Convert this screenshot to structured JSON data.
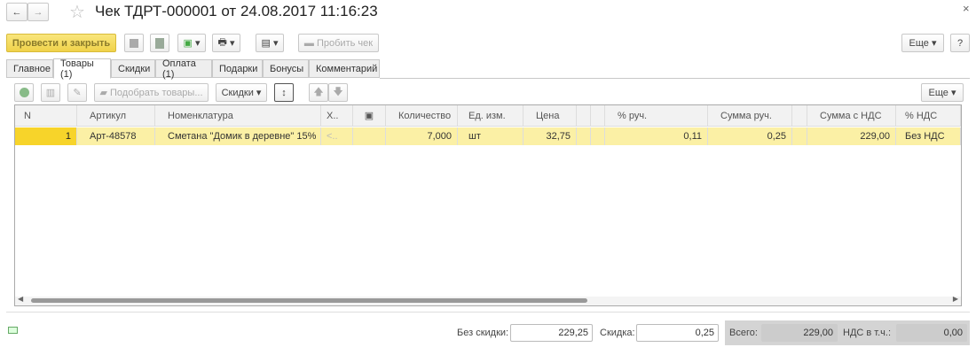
{
  "window": {
    "title": "Чек ТДРТ-000001 от 24.08.2017 11:16:23"
  },
  "toolbar": {
    "post_close": "Провести и закрыть",
    "print_receipt": "Пробить чек",
    "more": "Еще",
    "help": "?"
  },
  "tabs": [
    {
      "label": "Главное"
    },
    {
      "label": "Товары (1)",
      "active": true
    },
    {
      "label": "Скидки"
    },
    {
      "label": "Оплата (1)"
    },
    {
      "label": "Подарки"
    },
    {
      "label": "Бонусы"
    },
    {
      "label": "Комментарий"
    }
  ],
  "goods_toolbar": {
    "pick_goods": "Подобрать товары...",
    "discounts": "Скидки",
    "more": "Еще"
  },
  "table": {
    "columns": [
      "N",
      "Артикул",
      "Номенклатура",
      "Х..",
      "",
      "Количество",
      "Ед. изм.",
      "Цена",
      "",
      "",
      "% руч.",
      "Сумма руч.",
      "",
      "Сумма с НДС",
      "% НДС"
    ],
    "rows": [
      [
        "1",
        "Арт-48578",
        "Сметана \"Домик в деревне\" 15%",
        "<..",
        "",
        "7,000",
        "шт",
        "32,75",
        "",
        "",
        "0,11",
        "0,25",
        "",
        "229,00",
        "Без НДС"
      ]
    ]
  },
  "footer": {
    "no_discount_label": "Без скидки:",
    "no_discount_value": "229,25",
    "discount_label": "Скидка:",
    "discount_value": "0,25",
    "total_label": "Всего:",
    "total_value": "229,00",
    "vat_label": "НДС в т.ч.:",
    "vat_value": "0,00"
  },
  "colors": {
    "accent_button": "#f6dc5a",
    "row_selected": "#fbf0a5",
    "n_cell": "#f7d42a"
  }
}
